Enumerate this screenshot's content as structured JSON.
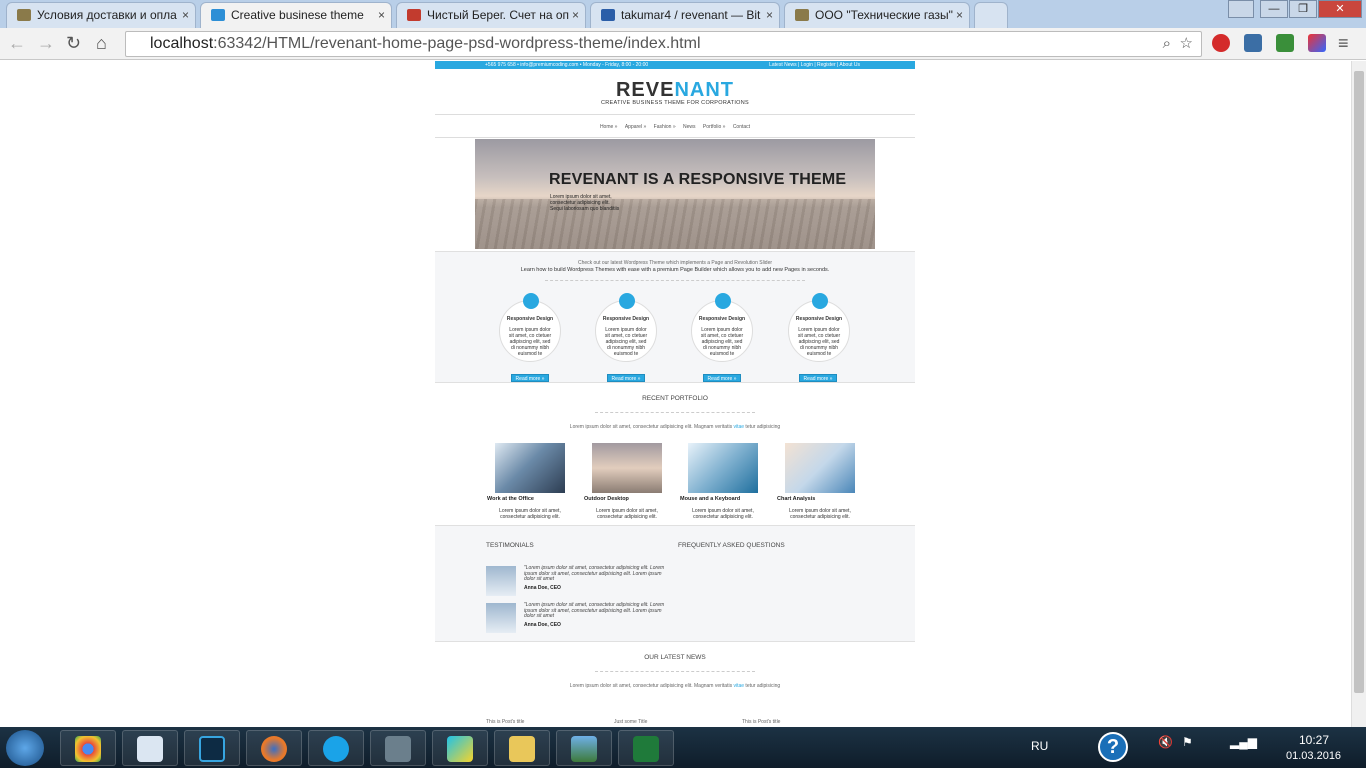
{
  "tabs": [
    {
      "label": "Условия доставки и опла",
      "color": "#8a7a4a"
    },
    {
      "label": "Creative businese theme",
      "color": "#2d8fd6"
    },
    {
      "label": "Чистый Берег. Счет на оп",
      "color": "#c23b2e"
    },
    {
      "label": "takumar4 / revenant — Bit",
      "color": "#2b5ea8"
    },
    {
      "label": "ООО \"Технические газы\"",
      "color": "#8a7a4a"
    }
  ],
  "tab_close": "×",
  "window": {
    "min": "—",
    "max": "❐",
    "close": "✕"
  },
  "url": {
    "host": "localhost",
    "path": ":63342/HTML/revenant-home-page-psd-wordpress-theme/index.html"
  },
  "nav_buttons": {
    "back": "←",
    "forward": "→",
    "reload": "↻",
    "home": "⌂",
    "menu": "≡"
  },
  "site": {
    "topbar": {
      "left": "+565 975 658   •  info@premiumcoding.com  •  Monday - Friday, 8:00 - 20:00",
      "right": "Latest News | Login | Register | About Us"
    },
    "logo_a": "REVE",
    "logo_b": "NANT",
    "tagline": "CREATIVE BUSINESS THEME FOR CORPORATIONS",
    "nav": [
      "Home »",
      "Apparel »",
      "Fashion »",
      "News",
      "Portfolio »",
      "Contact"
    ],
    "hero": {
      "title": "REVENANT IS A RESPONSIVE THEME",
      "text": "Lorem ipsum dolor sit amet, consectetur adipisicing elit. Sequi laboriosam quo blanditiis"
    },
    "intro": {
      "line1": "Check out our latest Wordpress Theme which implements a Page and Revolution Slider",
      "line2": "Learn how to build Wordpress Themes with ease with a premium Page Builder which allows you to add new Pages in seconds."
    },
    "features": [
      {
        "title": "Responsive Design",
        "text": "Lorem ipsum dolor sit amet, co ctetuer adipiscing elit, sed di nonummy nibh euismod te",
        "btn": "Read more »"
      },
      {
        "title": "Responsive Design",
        "text": "Lorem ipsum dolor sit amet, co ctetuer adipiscing elit, sed di nonummy nibh euismod te",
        "btn": "Read more »"
      },
      {
        "title": "Responsive Design",
        "text": "Lorem ipsum dolor sit amet, co ctetuer adipiscing elit, sed di nonummy nibh euismod te",
        "btn": "Read more »"
      },
      {
        "title": "Responsive Design",
        "text": "Lorem ipsum dolor sit amet, co ctetuer adipiscing elit, sed di nonummy nibh euismod te",
        "btn": "Read more »"
      }
    ],
    "portfolio": {
      "title": "RECENT PORTFOLIO",
      "subtitle_a": "Lorem ipsum dolor sit amet, consectetur adipisicing elit. Magnam veritatis ",
      "subtitle_link": "vitae",
      "subtitle_b": " tetur adipisicing",
      "items": [
        {
          "title": "Work at the Office",
          "text": "Lorem ipsum dolor sit amet, consectetur adipisicing elit."
        },
        {
          "title": "Outdoor Desktop",
          "text": "Lorem ipsum dolor sit amet, consectetur adipisicing elit."
        },
        {
          "title": "Mouse and a Keyboard",
          "text": "Lorem ipsum dolor sit amet, consectetur adipisicing elit."
        },
        {
          "title": "Chart Analysis",
          "text": "Lorem ipsum dolor sit amet, consectetur adipisicing elit."
        }
      ]
    },
    "testimonials": {
      "title": "TESTIMONIALS",
      "items": [
        {
          "quote": "\"Lorem ipsum dolor sit amet, consectetur adipisicing elit. Lorem ipsum dolor sit amet, consectetur adipisicing elit. Lorem ipsum dolor sit amet",
          "name": "Anna Doe, CEO"
        },
        {
          "quote": "\"Lorem ipsum dolor sit amet, consectetur adipisicing elit. Lorem ipsum dolor sit amet, consectetur adipisicing elit. Lorem ipsum dolor sit amet",
          "name": "Anna Doe, CEO"
        }
      ]
    },
    "faq": {
      "title": "FREQUENTLY ASKED QUESTIONS"
    },
    "news": {
      "title": "OUR LATEST NEWS",
      "subtitle_a": "Lorem ipsum dolor sit amet, consectetur adipisicing elit. Magnam veritatis ",
      "subtitle_link": "vitae",
      "subtitle_b": " tetur adipisicing",
      "posts": [
        "This is Post's title",
        "Just some Title",
        "This is Post's title"
      ]
    }
  },
  "taskbar": {
    "lang": "RU",
    "time": "10:27",
    "date": "01.03.2016"
  }
}
